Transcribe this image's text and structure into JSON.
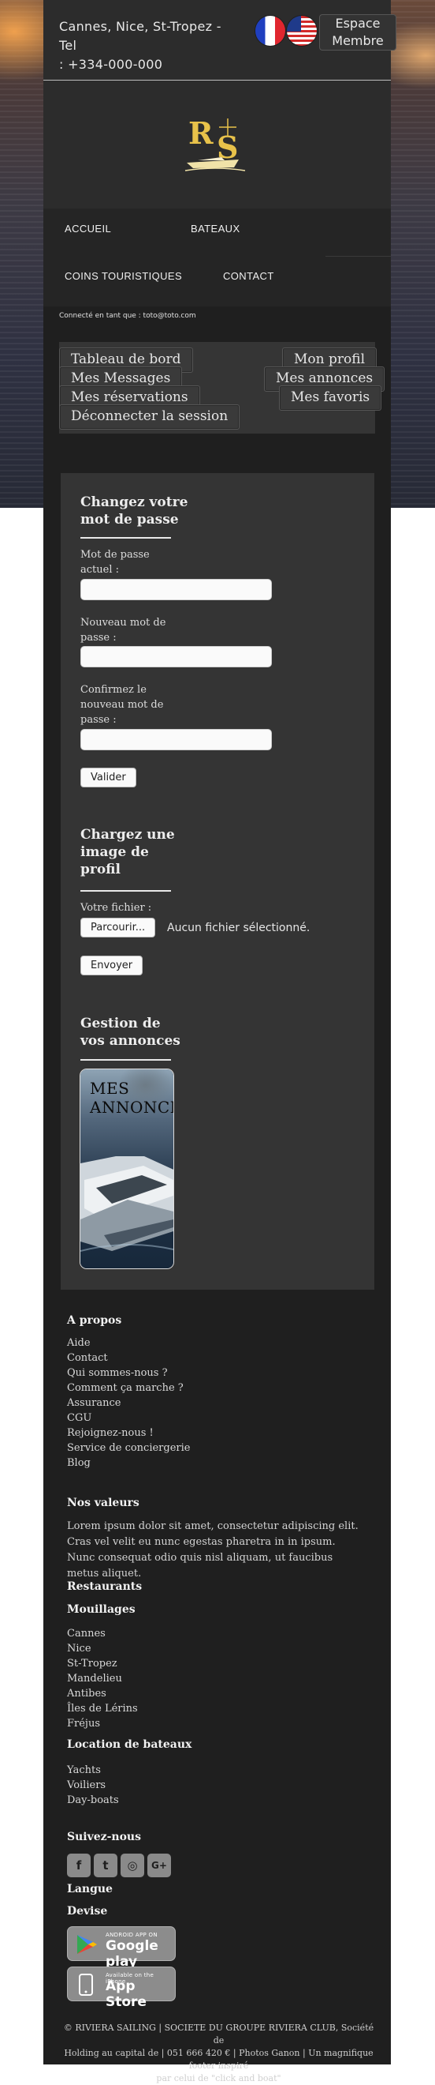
{
  "header": {
    "contact_line1": "Cannes, Nice, St-Tropez - Tel",
    "contact_line2": ": +334-000-000",
    "espace_membre_line1": "Espace",
    "espace_membre_line2": "Membre",
    "logo_letters": "RS"
  },
  "nav": {
    "accueil": "ACCUEIL",
    "bateaux": "BATEAUX",
    "coins": "COINS TOURISTIQUES",
    "contact": "CONTACT"
  },
  "connected_text": "Connecté en tant que : toto@toto.com",
  "member_buttons": {
    "tableau": "Tableau de bord",
    "messages": "Mes Messages",
    "reservations": "Mes réservations",
    "deconnecter": "Déconnecter la session",
    "profil": "Mon profil",
    "annonces": "Mes annonces",
    "favoris": "Mes favoris"
  },
  "password_section": {
    "title_line1": "Changez votre",
    "title_line2": "mot de passe",
    "current_label_line1": "Mot de passe",
    "current_label_line2": "actuel :",
    "new_label_line1": "Nouveau mot de",
    "new_label_line2": "passe :",
    "confirm_label_line1": "Confirmez le",
    "confirm_label_line2": "nouveau mot de",
    "confirm_label_line3": "passe :",
    "submit": "Valider"
  },
  "image_section": {
    "title_line1": "Chargez une",
    "title_line2": "image de",
    "title_line3": "profil",
    "file_label": "Votre fichier :",
    "browse": "Parcourir...",
    "file_status": "Aucun fichier sélectionné.",
    "submit": "Envoyer"
  },
  "ads_section": {
    "title_line1": "Gestion de",
    "title_line2": "vos annonces",
    "card_line1": "MES",
    "card_line2": "ANNONCES"
  },
  "footer": {
    "apropos_title": "A propos",
    "apropos_links": [
      "Aide",
      "Contact",
      "Qui sommes-nous ?",
      "Comment ça marche ?",
      "Assurance",
      "CGU",
      "Rejoignez-nous !",
      "Service de conciergerie",
      "Blog"
    ],
    "valeurs_title": "Nos valeurs",
    "valeurs_text": "Lorem ipsum dolor sit amet, consectetur adipiscing elit. Cras vel velit eu nunc egestas pharetra in in ipsum. Nunc consequat odio quis nisl aliquam, ut faucibus metus aliquet.",
    "restaurants_title": "Restaurants",
    "mouillages_title": "Mouillages",
    "mouillages_links": [
      "Cannes",
      "Nice",
      "St-Tropez",
      "Mandelieu",
      "Antibes",
      "Îles de Lérins",
      "Fréjus"
    ],
    "location_title": "Location de bateaux",
    "location_links": [
      "Yachts",
      "Voiliers",
      "Day-boats"
    ],
    "suivez_title": "Suivez-nous",
    "social": [
      "f",
      "t",
      "◎",
      "G+"
    ],
    "langue_title": "Langue",
    "devise_title": "Devise",
    "google_small": "ANDROID APP ON",
    "google_big": "Google play",
    "apple_small": "Available on the iPhone",
    "apple_big": "App Store",
    "copyright_line1": "© RIVIERA SAILING | SOCIETE DU GROUPE RIVIERA CLUB, Société de",
    "copyright_line2": "Holding au capital de | 051 666 420 € | Photos Ganon | Un magnifique footer inspiré",
    "copyright_line3": "par celui de \"click and boat\""
  }
}
